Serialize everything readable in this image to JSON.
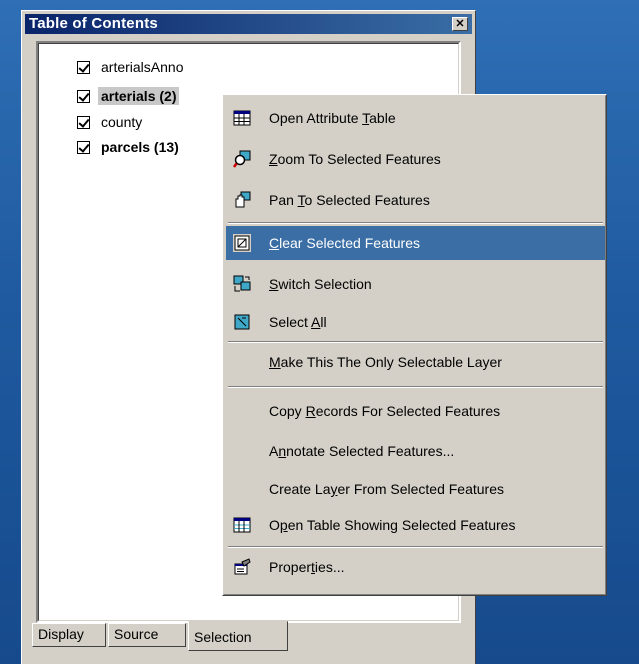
{
  "window": {
    "title": "Table of Contents",
    "close_glyph": "✕"
  },
  "layers": [
    {
      "name": "arterialsAnno",
      "checked": true,
      "bold": false
    },
    {
      "name": "arterials (2)",
      "checked": true,
      "bold": true
    },
    {
      "name": "county",
      "checked": true,
      "bold": false
    },
    {
      "name": "parcels (13)",
      "checked": true,
      "bold": true
    }
  ],
  "tabs": [
    {
      "label": "Display"
    },
    {
      "label": "Source"
    },
    {
      "label": "Selection",
      "active": true
    }
  ],
  "context_menu": {
    "items": [
      {
        "pre": "Open Attribute ",
        "u": "T",
        "post": "able",
        "icon": "attribute-table-icon"
      },
      {
        "pre": "",
        "u": "Z",
        "post": "oom To Selected Features",
        "icon": "zoom-to-selected-icon"
      },
      {
        "pre": "Pan ",
        "u": "T",
        "post": "o Selected Features",
        "icon": "pan-to-selected-icon"
      },
      {
        "pre": "",
        "u": "C",
        "post": "lear Selected Features",
        "icon": "clear-selection-icon",
        "highlighted": true
      },
      {
        "pre": "",
        "u": "S",
        "post": "witch Selection",
        "icon": "switch-selection-icon"
      },
      {
        "pre": "Select ",
        "u": "A",
        "post": "ll",
        "icon": "select-all-icon"
      },
      {
        "pre": "",
        "u": "M",
        "post": "ake This The Only Selectable Layer",
        "icon": ""
      },
      {
        "pre": "Copy ",
        "u": "R",
        "post": "ecords For Selected Features",
        "icon": ""
      },
      {
        "pre": "A",
        "u": "n",
        "post": "notate Selected Features...",
        "icon": ""
      },
      {
        "pre": "Create La",
        "u": "y",
        "post": "er From Selected Features",
        "icon": ""
      },
      {
        "pre": "O",
        "u": "p",
        "post": "en Table Showing Selected Features",
        "icon": "table-icon"
      },
      {
        "pre": "Proper",
        "u": "t",
        "post": "ies...",
        "icon": "properties-icon"
      }
    ]
  },
  "colors": {
    "desktop": "#1f5aa0",
    "title_bar": "#0a246a",
    "menu_highlight": "#3a6ea5",
    "face": "#d4d0c8"
  }
}
